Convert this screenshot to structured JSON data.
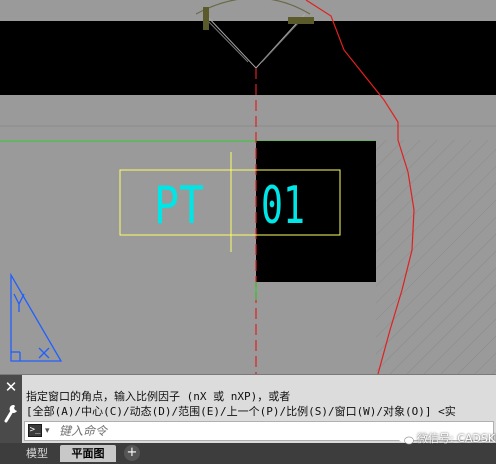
{
  "drawing": {
    "label_left": "PT",
    "label_right": "01",
    "colors": {
      "background": "#9a9a9a",
      "fill": "#000000",
      "text": "#00e5e5",
      "frame": "#ffff66",
      "red_line": "#e02020",
      "green_line": "#33cc33",
      "ucs_icon": "#2060ff",
      "olive": "#5a5a2a"
    }
  },
  "command_line": {
    "line1": "指定窗口的角点，输入比例因子 (nX 或 nXP)，或者",
    "line2": "[全部(A)/中心(C)/动态(D)/范围(E)/上一个(P)/比例(S)/窗口(W)/对象(O)] <实",
    "input_placeholder": "键入命令",
    "close_glyph": "✕",
    "prompt_glyph": ">_",
    "prompt_arrow": "▾"
  },
  "tabs": {
    "model": "模型",
    "layout": "平面图",
    "add": "+"
  },
  "watermark": {
    "text": "微信号: CADSKILL"
  }
}
